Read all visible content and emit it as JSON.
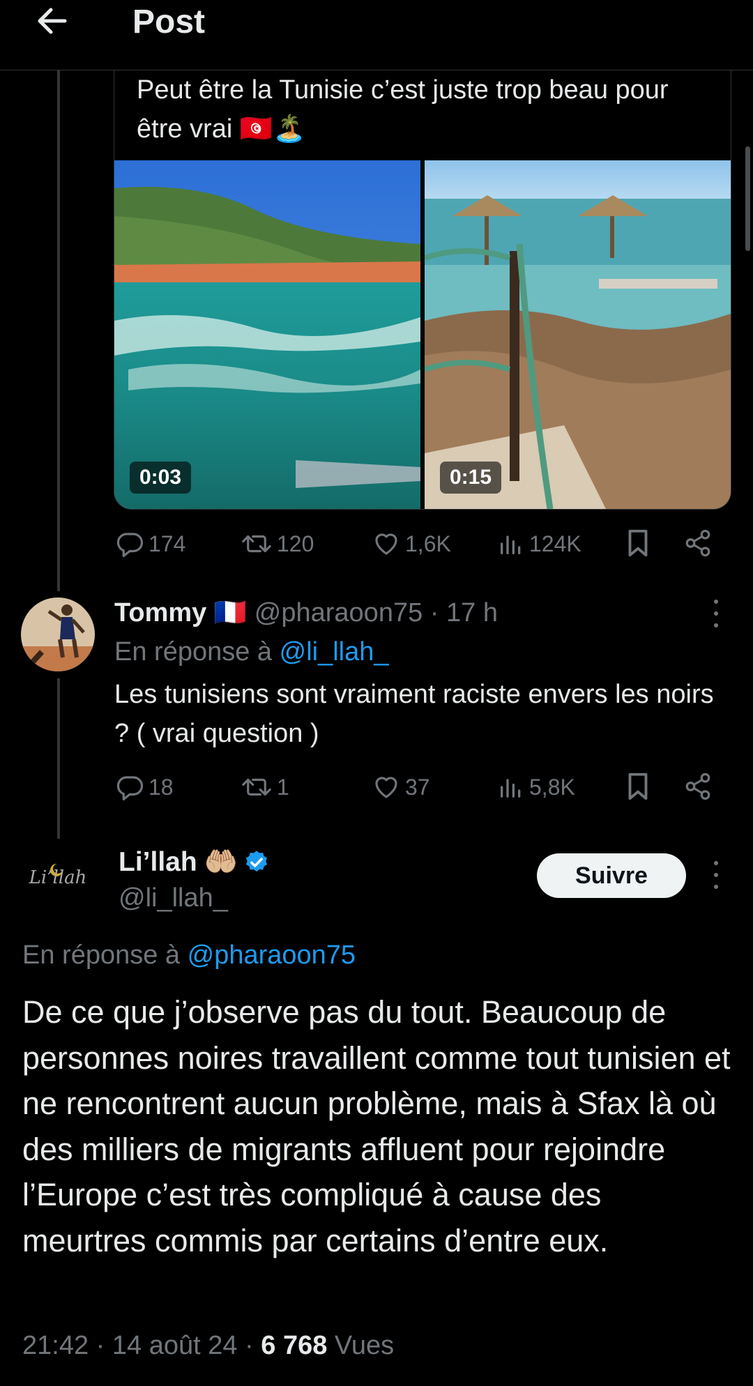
{
  "header": {
    "title": "Post"
  },
  "quoted_post": {
    "text": "Peut être la Tunisie c’est juste trop beau pour être vrai 🇹🇳🏝️",
    "media": [
      {
        "kind": "video",
        "duration": "0:03"
      },
      {
        "kind": "video",
        "duration": "0:15"
      }
    ],
    "stats": {
      "replies": "174",
      "reposts": "120",
      "likes": "1,6K",
      "views": "124K"
    }
  },
  "reply": {
    "name": "Tommy",
    "flag": "🇫🇷",
    "handle": "@pharaoon75",
    "time": "· 17 h",
    "reply_prefix": "En réponse à",
    "reply_to": "@li_llah_",
    "text": "Les tunisiens sont vraiment raciste envers les noirs ? ( vrai question )",
    "stats": {
      "replies": "18",
      "reposts": "1",
      "likes": "37",
      "views": "5,8K"
    }
  },
  "main_post": {
    "name": "Li’llah",
    "emoji": "🤲🏼",
    "handle": "@li_llah_",
    "avatar_text": "Li’llah",
    "follow_label": "Suivre",
    "reply_prefix": "En réponse à",
    "reply_to": "@pharaoon75",
    "text": "De ce que j’observe pas du tout. Beaucoup de personnes noires travaillent comme tout tunisien et ne rencontrent aucun problème, mais à Sfax là où des milliers de migrants affluent pour rejoindre l’Europe c’est très compliqué à cause des meurtres commis par certains d’entre eux.",
    "time": "21:42 · 14 août 24 ·",
    "views_count": "6 768",
    "views_label": "Vues"
  },
  "colors": {
    "background": "#000000",
    "text": "#e7e9ea",
    "muted": "#71767b",
    "link": "#1d9bf0",
    "verified": "#1d9bf0"
  }
}
